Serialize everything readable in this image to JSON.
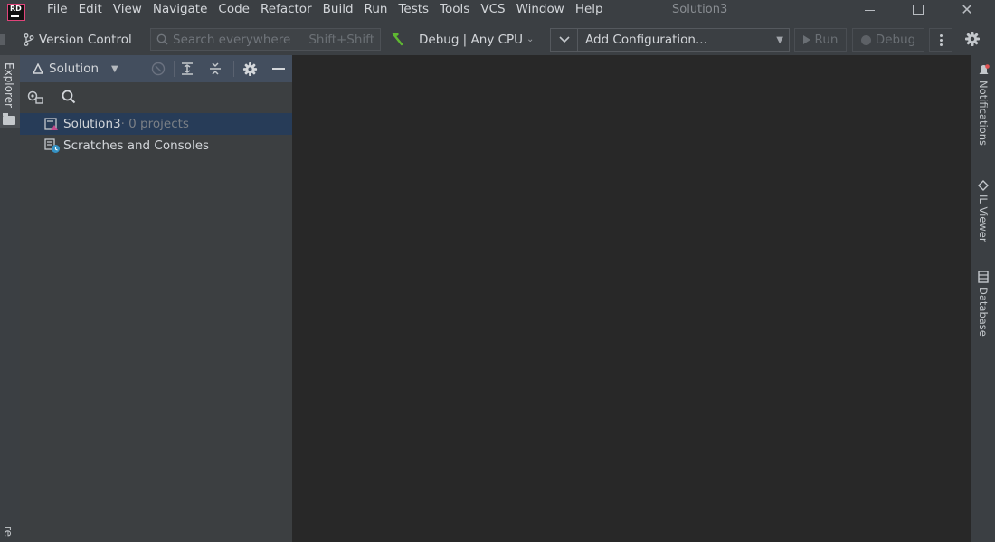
{
  "app": {
    "logo_text": "RD",
    "window_title": "Solution3"
  },
  "menu": [
    {
      "mnemonic": "F",
      "rest": "ile"
    },
    {
      "mnemonic": "E",
      "rest": "dit"
    },
    {
      "mnemonic": "V",
      "rest": "iew"
    },
    {
      "mnemonic": "N",
      "rest": "avigate"
    },
    {
      "mnemonic": "C",
      "rest": "ode"
    },
    {
      "mnemonic": "R",
      "rest": "efactor"
    },
    {
      "mnemonic": "B",
      "rest": "uild"
    },
    {
      "mnemonic": "R",
      "rest": "un"
    },
    {
      "mnemonic": "T",
      "rest": "ests"
    },
    {
      "mnemonic": "",
      "rest": "Tools"
    },
    {
      "mnemonic": "",
      "rest": "VCS"
    },
    {
      "mnemonic": "W",
      "rest": "indow"
    },
    {
      "mnemonic": "H",
      "rest": "elp"
    }
  ],
  "toolbar": {
    "version_control": "Version Control",
    "search_placeholder": "Search everywhere",
    "search_shortcut": "Shift+Shift",
    "debug_config": "Debug | Any CPU",
    "add_configuration": "Add Configuration...",
    "run": "Run",
    "debug": "Debug"
  },
  "left_strip": {
    "explorer": "Explorer",
    "bottom": "re"
  },
  "panel": {
    "title": "Solution",
    "tree": [
      {
        "name": "Solution3",
        "detail": " · 0 projects",
        "selected": true
      },
      {
        "name": "Scratches and Consoles",
        "detail": "",
        "selected": false
      }
    ]
  },
  "right_strip": {
    "notifications": "Notifications",
    "il_viewer": "IL Viewer",
    "database": "Database"
  },
  "colors": {
    "accent": "#e0447a",
    "selection": "#273c58",
    "panel_header": "#434e5e",
    "build_green": "#5fb832"
  }
}
